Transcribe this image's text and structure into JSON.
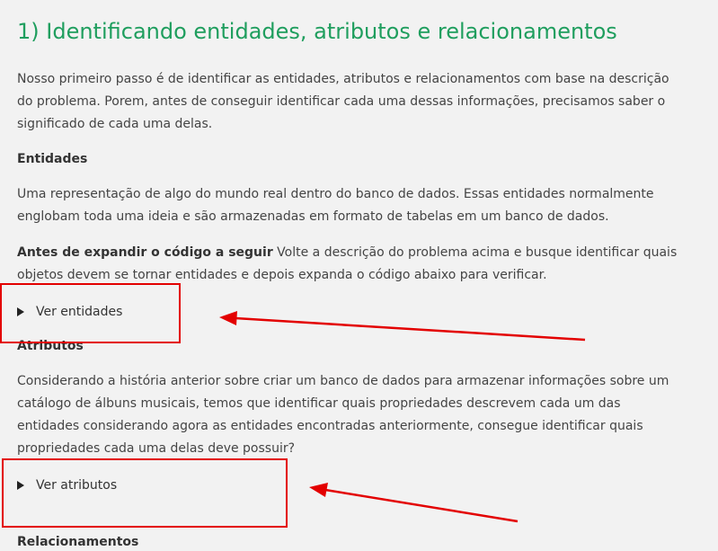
{
  "page": {
    "title": "1) Identificando entidades, atributos e relacionamentos",
    "intro": "Nosso primeiro passo é de identificar as entidades, atributos e relacionamentos com base na descrição do problema. Porem, antes de conseguir identificar cada uma dessas informações, precisamos saber o significado de cada uma delas.",
    "sections": {
      "entidades": {
        "heading": "Entidades",
        "text": "Uma representação de algo do mundo real dentro do banco de dados. Essas entidades normalmente englobam toda uma ideia e são armazenadas em formato de tabelas em um banco de dados.",
        "prompt_bold": "Antes de expandir o código a seguir",
        "prompt_text": " Volte a descrição do problema acima e busque identificar quais objetos devem se tornar entidades e depois expanda o código abaixo para verificar.",
        "toggle_label": "Ver entidades"
      },
      "atributos": {
        "heading": "Atributos",
        "text": "Considerando a história anterior sobre criar um banco de dados para armazenar informações sobre um catálogo de álbuns musicais, temos que identificar quais propriedades descrevem cada um das entidades considerando agora as entidades encontradas anteriormente, consegue identificar quais propriedades cada uma delas deve possuir?",
        "toggle_label": "Ver atributos"
      },
      "relacionamentos": {
        "heading": "Relacionamentos"
      }
    }
  },
  "annotations": {
    "color": "#e30000",
    "highlight_targets": [
      "Ver entidades",
      "Ver atributos"
    ]
  }
}
